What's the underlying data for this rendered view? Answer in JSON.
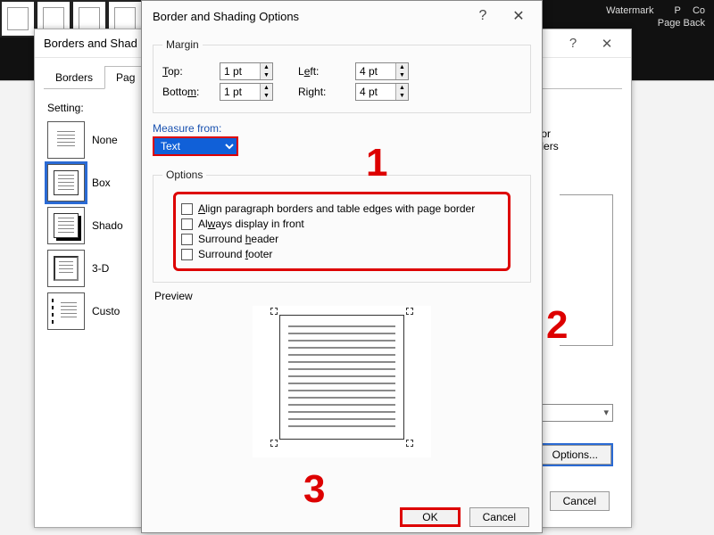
{
  "ribbon": {
    "watermark": "Watermark",
    "p": "P",
    "co": "Co",
    "pageback": "Page Back"
  },
  "back_dialog": {
    "title": "Borders and Shad",
    "help": "?",
    "close": "✕",
    "tabs": {
      "borders": "Borders",
      "page": "Pag"
    },
    "setting_header": "Setting:",
    "settings": {
      "none": "None",
      "box": "Box",
      "shadow": "Shado",
      "threeD": "3-D",
      "custom": "Custo"
    },
    "right_text": {
      "l1": "low or",
      "l2": "borders"
    },
    "options_btn": "Options...",
    "cancel": "Cancel"
  },
  "front_dialog": {
    "title": "Border and Shading Options",
    "help": "?",
    "close": "✕",
    "margin_legend": "Margin",
    "top_lbl": "Top:",
    "bottom_lbl": "Bottom:",
    "left_lbl": "Left:",
    "right_lbl": "Right:",
    "top_val": "1 pt",
    "bottom_val": "1 pt",
    "left_val": "4 pt",
    "right_val": "4 pt",
    "measure_lbl": "Measure from:",
    "measure_val": "Text",
    "options_legend": "Options",
    "opt1_a": "A",
    "opt1_b": "lign paragraph borders and table edges with page border",
    "opt2_a": "Al",
    "opt2_b": "w",
    "opt2_c": "ays display in front",
    "opt3_a": "Surround ",
    "opt3_b": "h",
    "opt3_c": "eader",
    "opt4_a": "Surround ",
    "opt4_b": "f",
    "opt4_c": "ooter",
    "preview_lbl": "Preview",
    "ok": "OK",
    "cancel": "Cancel"
  },
  "markers": {
    "m1": "1",
    "m2": "2",
    "m3": "3"
  }
}
